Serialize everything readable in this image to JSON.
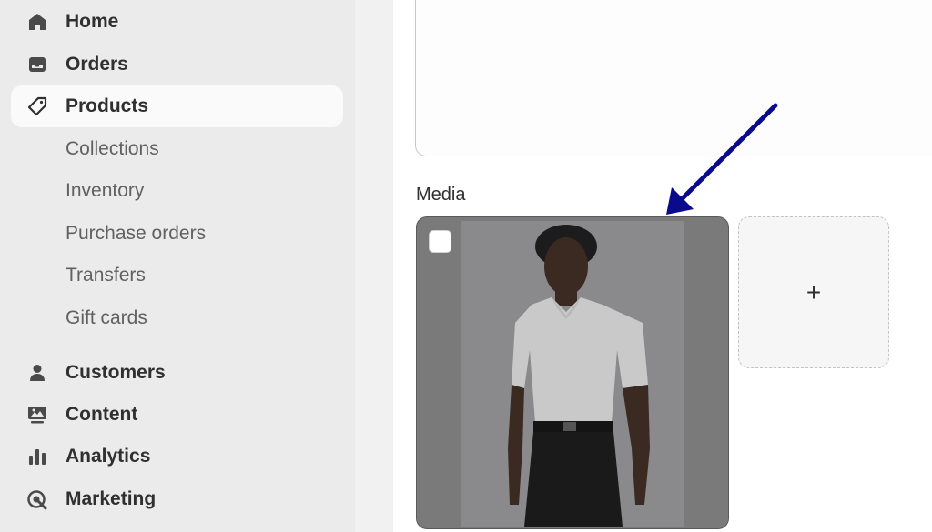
{
  "sidebar": {
    "items": [
      {
        "label": "Home",
        "icon": "home-icon"
      },
      {
        "label": "Orders",
        "icon": "inbox-icon"
      },
      {
        "label": "Products",
        "icon": "tag-icon",
        "active": true
      }
    ],
    "sub_items": [
      "Collections",
      "Inventory",
      "Purchase orders",
      "Transfers",
      "Gift cards"
    ],
    "items_bottom": [
      {
        "label": "Customers",
        "icon": "person-icon"
      },
      {
        "label": "Content",
        "icon": "content-icon"
      },
      {
        "label": "Analytics",
        "icon": "bar-chart-icon"
      },
      {
        "label": "Marketing",
        "icon": "target-icon"
      }
    ]
  },
  "main": {
    "media_label": "Media",
    "add_media_symbol": "+"
  },
  "colors": {
    "accent_arrow": "#0a0a8c",
    "sidebar_bg": "#ebebeb",
    "active_bg": "#fafafa"
  }
}
